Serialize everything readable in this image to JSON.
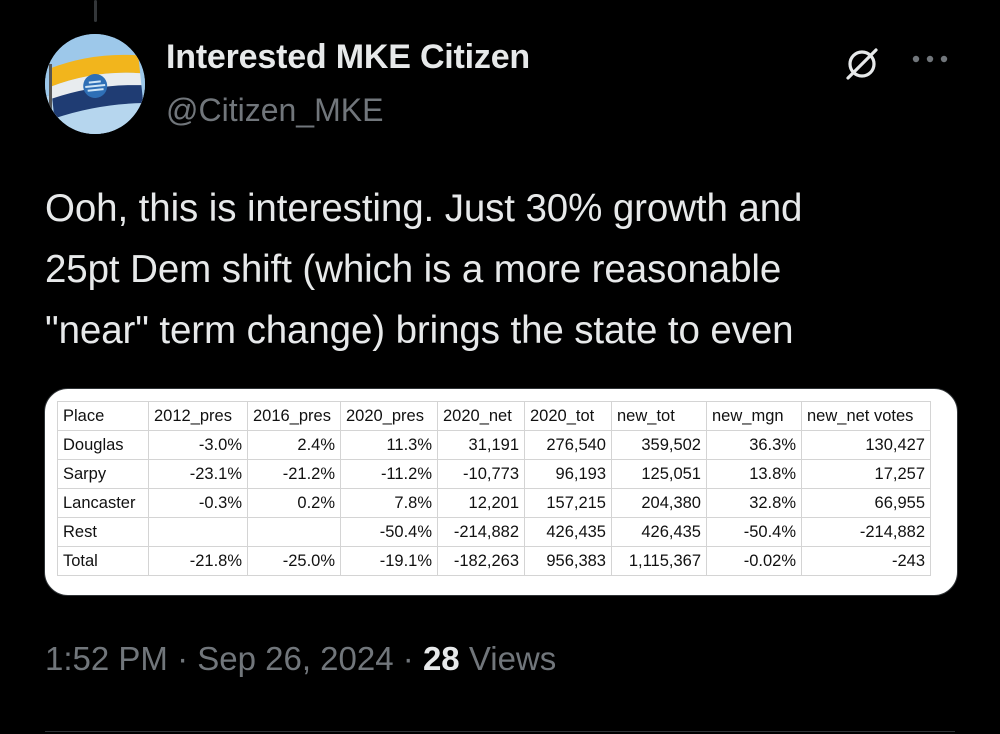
{
  "author": {
    "display_name": "Interested MKE Citizen",
    "handle": "@Citizen_MKE"
  },
  "icons": {
    "grok": "grok-icon",
    "more": "more-horizontal-icon"
  },
  "tweet": {
    "text": "Ooh, this is interesting. Just 30% growth and\n25pt Dem shift (which is a more reasonable\n\"near\" term change) brings the state to even"
  },
  "table": {
    "headers": [
      "Place",
      "2012_pres",
      "2016_pres",
      "2020_pres",
      "2020_net",
      "2020_tot",
      "new_tot",
      "new_mgn",
      "new_net votes"
    ],
    "rows": [
      [
        "Douglas",
        "-3.0%",
        "2.4%",
        "11.3%",
        "31,191",
        "276,540",
        "359,502",
        "36.3%",
        "130,427"
      ],
      [
        "Sarpy",
        "-23.1%",
        "-21.2%",
        "-11.2%",
        "-10,773",
        "96,193",
        "125,051",
        "13.8%",
        "17,257"
      ],
      [
        "Lancaster",
        "-0.3%",
        "0.2%",
        "7.8%",
        "12,201",
        "157,215",
        "204,380",
        "32.8%",
        "66,955"
      ],
      [
        "Rest",
        "",
        "",
        "-50.4%",
        "-214,882",
        "426,435",
        "426,435",
        "-50.4%",
        "-214,882"
      ],
      [
        "Total",
        "-21.8%",
        "-25.0%",
        "-19.1%",
        "-182,263",
        "956,383",
        "1,115,367",
        "-0.02%",
        "-243"
      ]
    ]
  },
  "meta": {
    "time": "1:52 PM",
    "separator": "·",
    "date": "Sep 26, 2024",
    "views_count": "28",
    "views_label": "Views"
  },
  "colors": {
    "background": "#000000",
    "text_primary": "#e7e9ea",
    "text_secondary": "#71767b",
    "flag_gold": "#f2b51c",
    "flag_blue": "#1f3c73"
  }
}
